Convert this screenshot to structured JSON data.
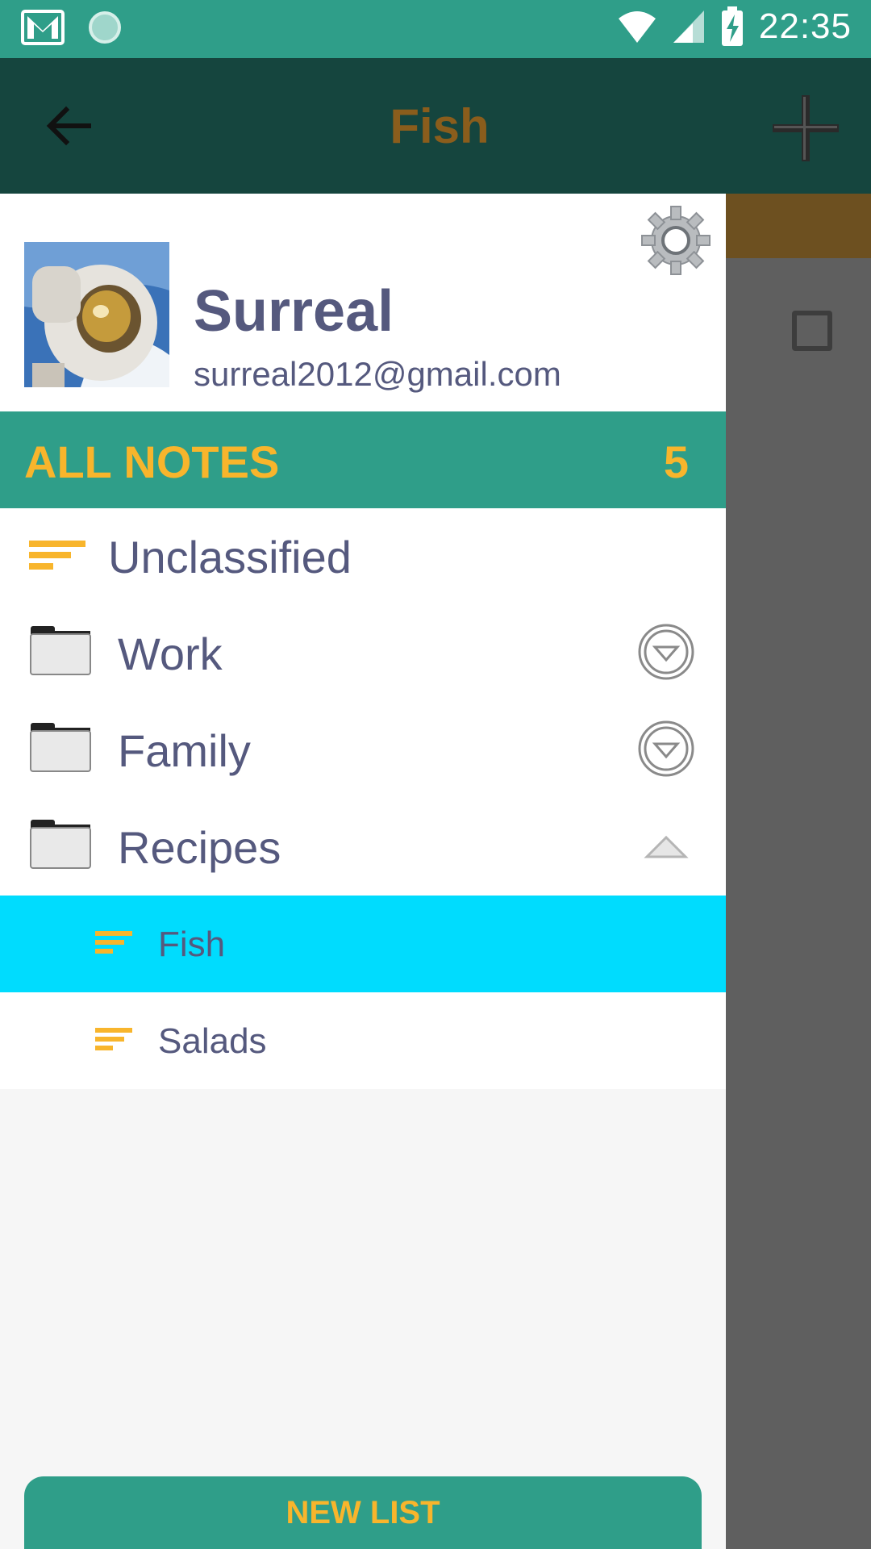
{
  "status_bar": {
    "time": "22:35"
  },
  "app_bar": {
    "title": "Fish"
  },
  "profile": {
    "name": "Surreal",
    "email": "surreal2012@gmail.com"
  },
  "all_notes": {
    "label": "ALL NOTES",
    "count": "5"
  },
  "items": [
    {
      "label": "Unclassified"
    },
    {
      "label": "Work"
    },
    {
      "label": "Family"
    },
    {
      "label": "Recipes"
    }
  ],
  "sub_items": [
    {
      "label": "Fish"
    },
    {
      "label": "Salads"
    }
  ],
  "new_list_label": "NEW LIST",
  "colors": {
    "primary": "#2f9e89",
    "dark_toolbar": "#15453e",
    "accent": "#f8b52c",
    "text": "#55597e",
    "selected": "#00dcfe"
  }
}
